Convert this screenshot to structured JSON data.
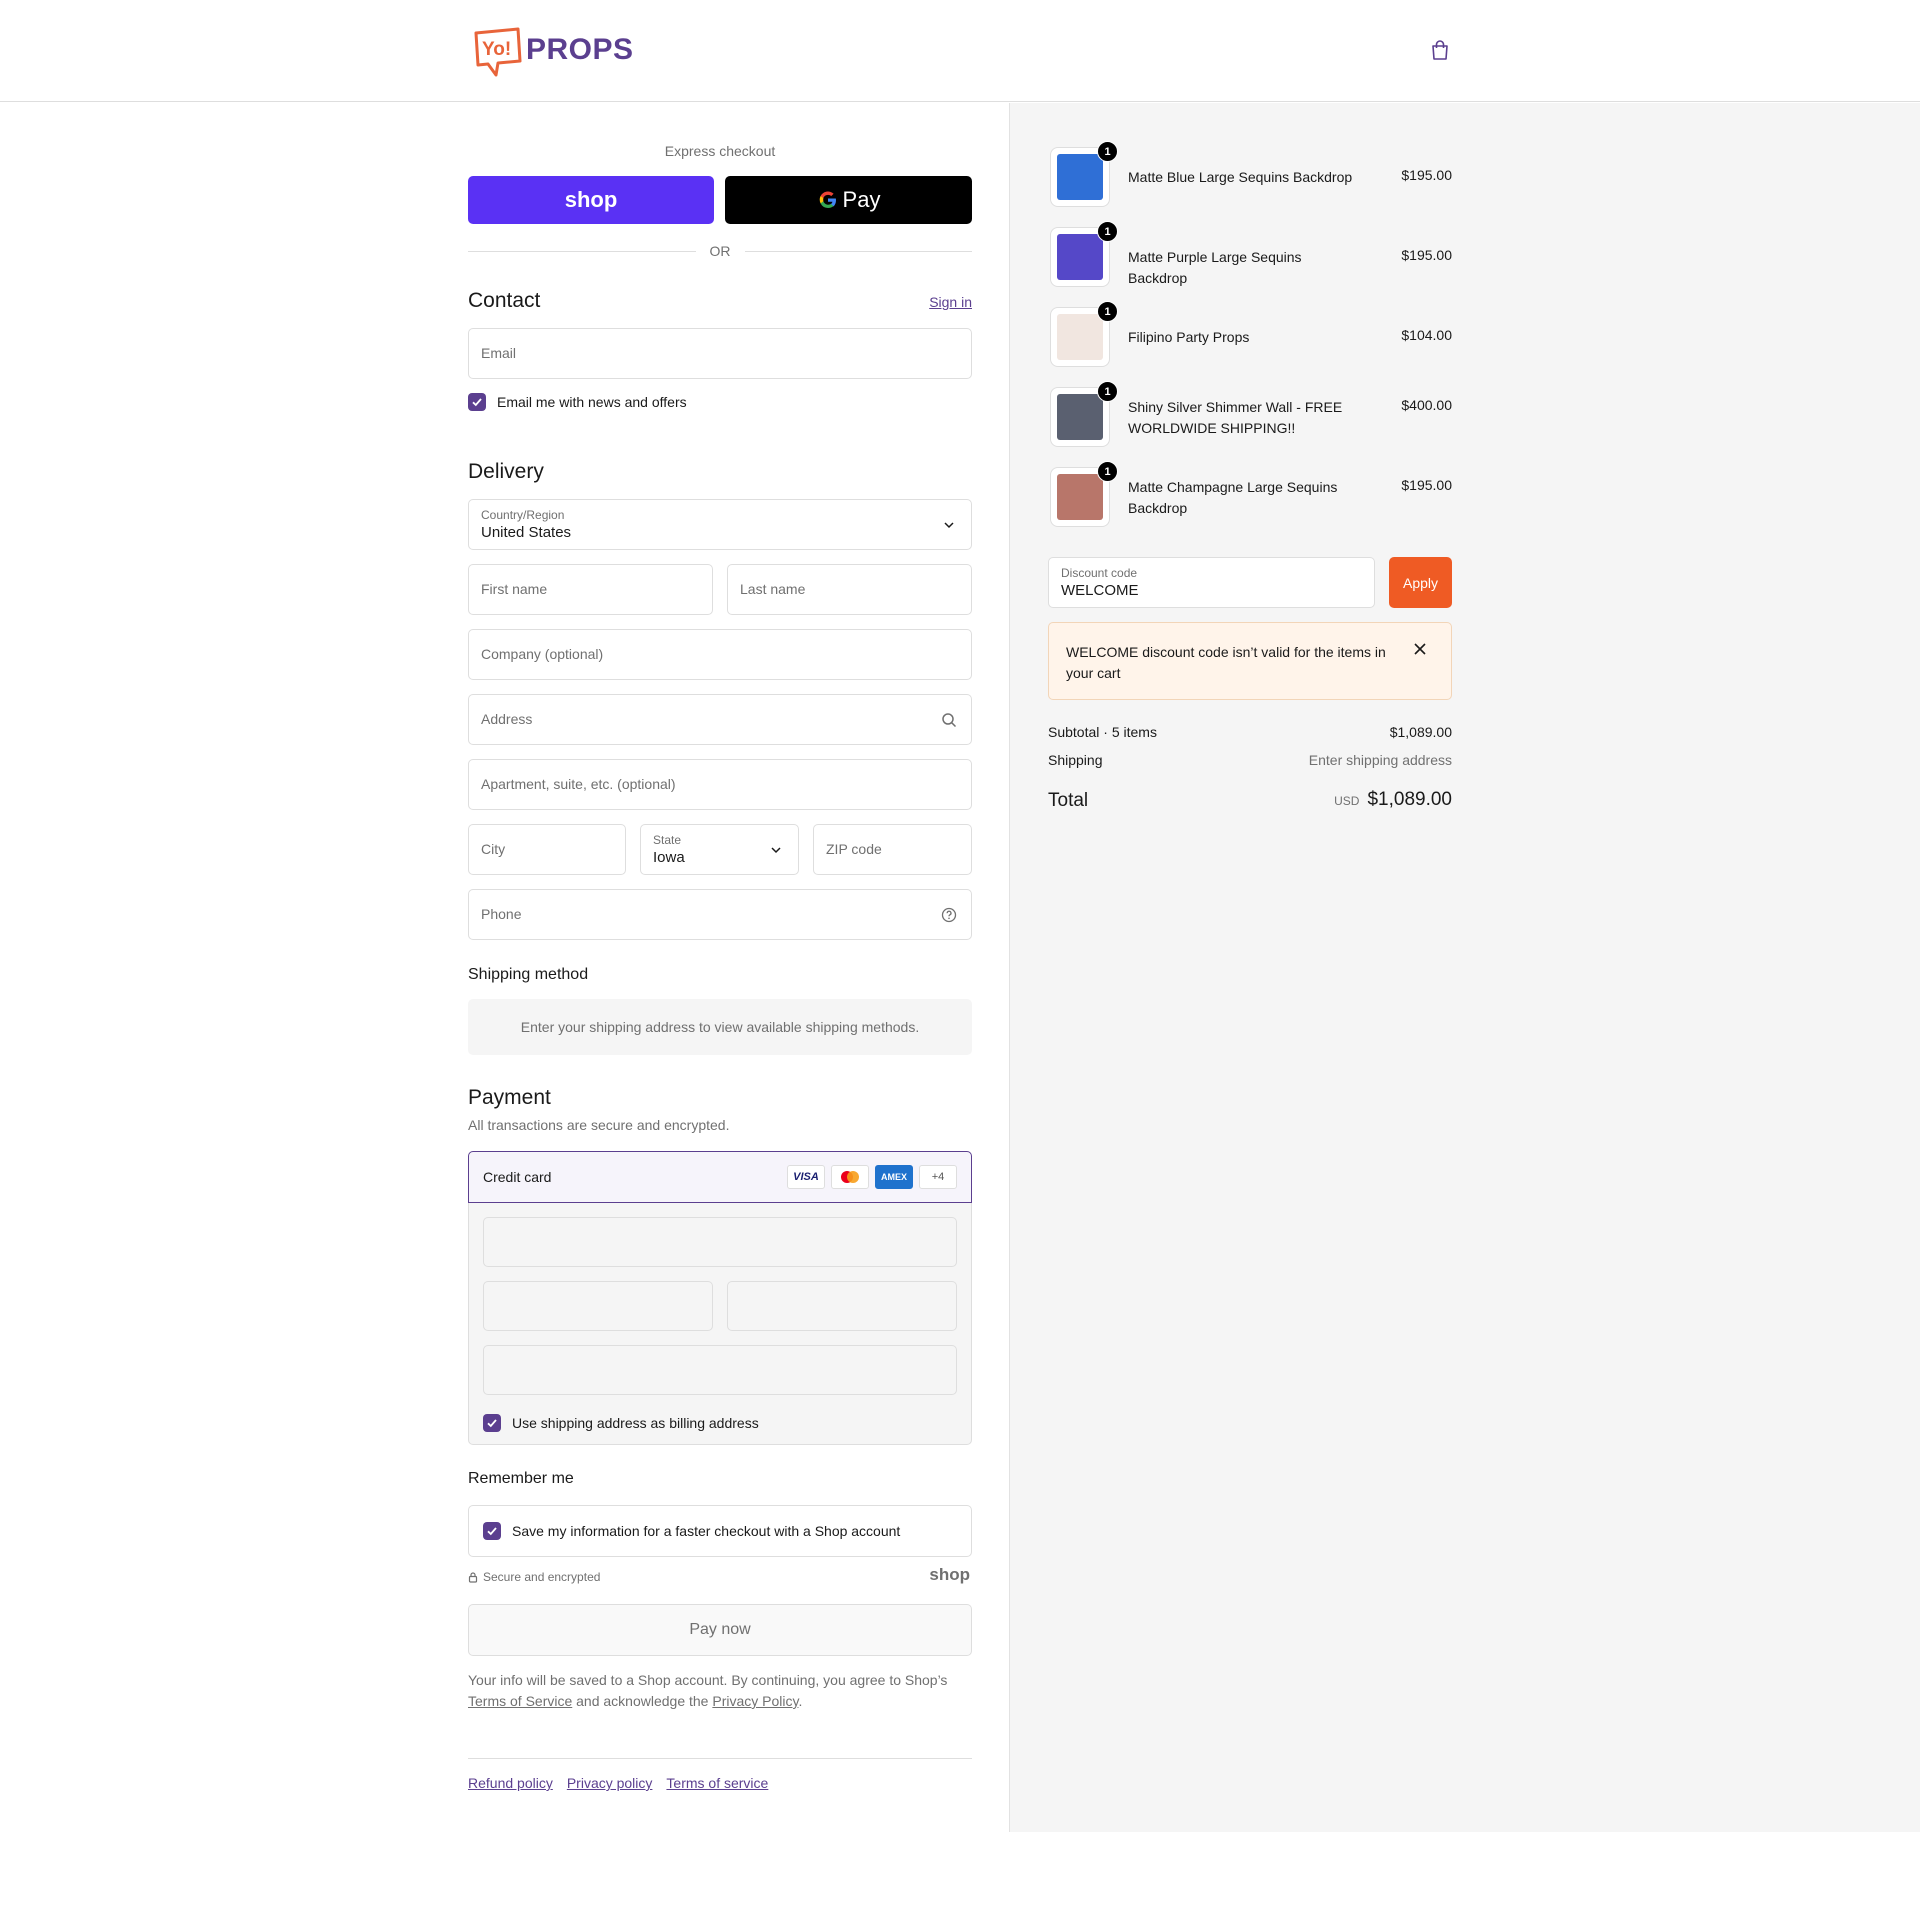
{
  "header": {
    "logo_text": "PROPS",
    "logo_mark": "Yo!",
    "cart_icon": "shopping-bag-icon"
  },
  "express": {
    "title": "Express checkout",
    "shop_label": "shop",
    "gpay_label": "Pay",
    "or_label": "OR"
  },
  "contact": {
    "title": "Contact",
    "sign_in": "Sign in",
    "email_placeholder": "Email",
    "news_label": "Email me with news and offers",
    "news_checked": true
  },
  "delivery": {
    "title": "Delivery",
    "country_label": "Country/Region",
    "country_value": "United States",
    "first_name": "First name",
    "last_name": "Last name",
    "company": "Company (optional)",
    "address": "Address",
    "apartment": "Apartment, suite, etc. (optional)",
    "city": "City",
    "state_label": "State",
    "state_value": "Iowa",
    "zip": "ZIP code",
    "phone": "Phone"
  },
  "shipping": {
    "title": "Shipping method",
    "message": "Enter your shipping address to view available shipping methods."
  },
  "payment": {
    "title": "Payment",
    "subtitle": "All transactions are secure and encrypted.",
    "method": "Credit card",
    "cards": [
      "VISA",
      "",
      "AMEX",
      "+4"
    ],
    "billing_label": "Use shipping address as billing address"
  },
  "remember": {
    "title": "Remember me",
    "save_label": "Save my information for a faster checkout with a Shop account",
    "secure_label": "Secure and encrypted",
    "shop_mark": "shop"
  },
  "pay_now": "Pay now",
  "legal": {
    "part1": "Your info will be saved to a Shop account. By continuing, you agree to Shop’s",
    "tos": "Terms of Service",
    "part2": "and acknowledge the",
    "privacy": "Privacy Policy",
    "period": "."
  },
  "footer": {
    "links": [
      "Refund policy",
      "Privacy policy",
      "Terms of service"
    ]
  },
  "summary": {
    "items": [
      {
        "name": "Matte Blue Large Sequins Backdrop",
        "price": "$195.00",
        "qty": "1",
        "color": "#2f6fd6"
      },
      {
        "name": "Matte Purple Large Sequins Backdrop",
        "price": "$195.00",
        "qty": "1",
        "color": "#5548c8"
      },
      {
        "name": "Filipino Party Props",
        "price": "$104.00",
        "qty": "1",
        "color": "#f1e6e0"
      },
      {
        "name": "Shiny Silver Shimmer Wall - FREE WORLDWIDE SHIPPING!!",
        "price": "$400.00",
        "qty": "1",
        "color": "#5a6070"
      },
      {
        "name": "Matte Champagne Large Sequins Backdrop",
        "price": "$195.00",
        "qty": "1",
        "color": "#b8766a"
      }
    ],
    "discount_label": "Discount code",
    "discount_value": "WELCOME",
    "apply_label": "Apply",
    "warning": "WELCOME discount code isn’t valid for the items in your cart",
    "subtotal_label": "Subtotal · 5 items",
    "subtotal_value": "$1,089.00",
    "shipping_label": "Shipping",
    "shipping_value": "Enter shipping address",
    "total_label": "Total",
    "total_currency": "USD",
    "total_value": "$1,089.00"
  },
  "colors": {
    "brand_purple": "#5b3f8f",
    "shop_purple": "#5a31f4",
    "apply_orange": "#ef5b24",
    "logo_orange": "#e8643a"
  }
}
